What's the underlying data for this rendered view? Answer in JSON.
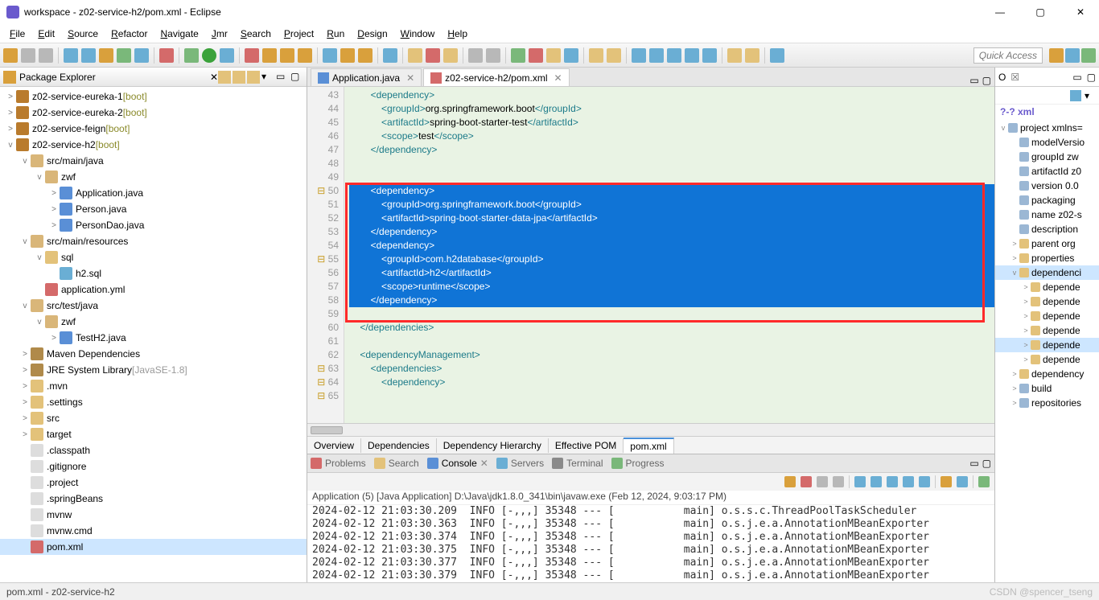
{
  "window": {
    "title": "workspace - z02-service-h2/pom.xml - Eclipse",
    "min": "—",
    "max": "▢",
    "close": "✕"
  },
  "menus": [
    "File",
    "Edit",
    "Source",
    "Refactor",
    "Navigate",
    "Jmr",
    "Search",
    "Project",
    "Run",
    "Design",
    "Window",
    "Help"
  ],
  "quick_access": "Quick Access",
  "pe": {
    "title": "Package Explorer",
    "items": [
      {
        "d": 0,
        "tw": ">",
        "ic": "ic-prj",
        "label": "z02-service-eureka-1",
        "suffix": " [boot]"
      },
      {
        "d": 0,
        "tw": ">",
        "ic": "ic-prj",
        "label": "z02-service-eureka-2",
        "suffix": " [boot]"
      },
      {
        "d": 0,
        "tw": ">",
        "ic": "ic-prj",
        "label": "z02-service-feign",
        "suffix": " [boot]"
      },
      {
        "d": 0,
        "tw": "v",
        "ic": "ic-prj",
        "label": "z02-service-h2",
        "suffix": " [boot]"
      },
      {
        "d": 1,
        "tw": "v",
        "ic": "ic-pkg",
        "label": "src/main/java"
      },
      {
        "d": 2,
        "tw": "v",
        "ic": "ic-pkg",
        "label": "zwf"
      },
      {
        "d": 3,
        "tw": ">",
        "ic": "ic-java",
        "label": "Application.java"
      },
      {
        "d": 3,
        "tw": ">",
        "ic": "ic-java",
        "label": "Person.java"
      },
      {
        "d": 3,
        "tw": ">",
        "ic": "ic-java",
        "label": "PersonDao.java"
      },
      {
        "d": 1,
        "tw": "v",
        "ic": "ic-pkg",
        "label": "src/main/resources"
      },
      {
        "d": 2,
        "tw": "v",
        "ic": "ic-fld",
        "label": "sql"
      },
      {
        "d": 3,
        "tw": "",
        "ic": "ic-sql",
        "label": "h2.sql"
      },
      {
        "d": 2,
        "tw": "",
        "ic": "ic-yml",
        "label": "application.yml"
      },
      {
        "d": 1,
        "tw": "v",
        "ic": "ic-pkg",
        "label": "src/test/java"
      },
      {
        "d": 2,
        "tw": "v",
        "ic": "ic-pkg",
        "label": "zwf"
      },
      {
        "d": 3,
        "tw": ">",
        "ic": "ic-java",
        "label": "TestH2.java"
      },
      {
        "d": 1,
        "tw": ">",
        "ic": "ic-lib",
        "label": "Maven Dependencies"
      },
      {
        "d": 1,
        "tw": ">",
        "ic": "ic-lib",
        "label": "JRE System Library",
        "suffix": " [JavaSE-1.8]",
        "sfx": "javase"
      },
      {
        "d": 1,
        "tw": ">",
        "ic": "ic-fld",
        "label": ".mvn"
      },
      {
        "d": 1,
        "tw": ">",
        "ic": "ic-fld",
        "label": ".settings"
      },
      {
        "d": 1,
        "tw": ">",
        "ic": "ic-fld",
        "label": "src"
      },
      {
        "d": 1,
        "tw": ">",
        "ic": "ic-fld",
        "label": "target"
      },
      {
        "d": 1,
        "tw": "",
        "ic": "ic-file",
        "label": ".classpath"
      },
      {
        "d": 1,
        "tw": "",
        "ic": "ic-file",
        "label": ".gitignore"
      },
      {
        "d": 1,
        "tw": "",
        "ic": "ic-file",
        "label": ".project"
      },
      {
        "d": 1,
        "tw": "",
        "ic": "ic-file",
        "label": ".springBeans"
      },
      {
        "d": 1,
        "tw": "",
        "ic": "ic-file",
        "label": "mvnw"
      },
      {
        "d": 1,
        "tw": "",
        "ic": "ic-file",
        "label": "mvnw.cmd"
      },
      {
        "d": 1,
        "tw": "",
        "ic": "ic-xml",
        "label": "pom.xml",
        "sel": true
      }
    ]
  },
  "editor": {
    "tabs": [
      {
        "label": "Application.java",
        "ic": "ic-java",
        "active": false
      },
      {
        "label": "z02-service-h2/pom.xml",
        "ic": "ic-xml",
        "active": true
      }
    ],
    "lines": [
      {
        "n": 43,
        "html": "        <span class='tag'>&lt;dependency&gt;</span>"
      },
      {
        "n": 44,
        "html": "            <span class='tag'>&lt;groupId&gt;</span><span class='txt'>org.springframework.boot</span><span class='tag'>&lt;/groupId&gt;</span>"
      },
      {
        "n": 45,
        "html": "            <span class='tag'>&lt;artifactId&gt;</span><span class='txt'>spring-boot-starter-test</span><span class='tag'>&lt;/artifactId&gt;</span>"
      },
      {
        "n": 46,
        "html": "            <span class='tag'>&lt;scope&gt;</span><span class='txt'>test</span><span class='tag'>&lt;/scope&gt;</span>"
      },
      {
        "n": 47,
        "html": "        <span class='tag'>&lt;/dependency&gt;</span>"
      },
      {
        "n": 48,
        "html": ""
      },
      {
        "n": 49,
        "html": ""
      },
      {
        "n": 50,
        "sel": true,
        "warn": true,
        "html": "        &lt;dependency&gt;"
      },
      {
        "n": 51,
        "sel": true,
        "html": "            &lt;groupId&gt;org.springframework.boot&lt;/groupId&gt;"
      },
      {
        "n": 52,
        "sel": true,
        "html": "            &lt;artifactId&gt;spring-boot-starter-data-jpa&lt;/artifactId&gt;"
      },
      {
        "n": 53,
        "sel": true,
        "html": "        &lt;/dependency&gt;"
      },
      {
        "n": 54,
        "sel": true,
        "html": ""
      },
      {
        "n": 55,
        "sel": true,
        "warn": true,
        "html": "        &lt;dependency&gt;"
      },
      {
        "n": 56,
        "sel": true,
        "html": "            &lt;groupId&gt;com.h2database&lt;/groupId&gt;"
      },
      {
        "n": 57,
        "sel": true,
        "html": "            &lt;artifactId&gt;h2&lt;/artifactId&gt;"
      },
      {
        "n": 58,
        "sel": true,
        "html": "            &lt;scope&gt;runtime&lt;/scope&gt;"
      },
      {
        "n": 59,
        "sel": true,
        "html": "        &lt;/dependency&gt;"
      },
      {
        "n": 60,
        "html": ""
      },
      {
        "n": 61,
        "html": "    <span class='tag'>&lt;/dependencies&gt;</span>"
      },
      {
        "n": 62,
        "html": ""
      },
      {
        "n": 63,
        "warn": true,
        "html": "    <span class='tag'>&lt;dependencyManagement&gt;</span>"
      },
      {
        "n": 64,
        "warn": true,
        "html": "        <span class='tag'>&lt;dependencies&gt;</span>"
      },
      {
        "n": 65,
        "warn": true,
        "html": "            <span class='tag'>&lt;dependency&gt;</span>"
      }
    ],
    "bottom_tabs": [
      "Overview",
      "Dependencies",
      "Dependency Hierarchy",
      "Effective POM",
      "pom.xml"
    ],
    "bottom_active": 4
  },
  "views": {
    "tabs": [
      {
        "label": "Problems",
        "ic": "#d46a6a"
      },
      {
        "label": "Search",
        "ic": "#e3c27a"
      },
      {
        "label": "Console",
        "ic": "#5a8fd6",
        "active": true
      },
      {
        "label": "Servers",
        "ic": "#6aaed4"
      },
      {
        "label": "Terminal",
        "ic": "#8a8a8a"
      },
      {
        "label": "Progress",
        "ic": "#7ab87a"
      }
    ],
    "console_header": "Application (5) [Java Application] D:\\Java\\jdk1.8.0_341\\bin\\javaw.exe (Feb 12, 2024, 9:03:17 PM)",
    "console_lines": [
      "2024-02-12 21:03:30.209  INFO [-,,,] 35348 --- [           main] o.s.s.c.ThreadPoolTaskScheduler",
      "2024-02-12 21:03:30.363  INFO [-,,,] 35348 --- [           main] o.s.j.e.a.AnnotationMBeanExporter",
      "2024-02-12 21:03:30.374  INFO [-,,,] 35348 --- [           main] o.s.j.e.a.AnnotationMBeanExporter",
      "2024-02-12 21:03:30.375  INFO [-,,,] 35348 --- [           main] o.s.j.e.a.AnnotationMBeanExporter",
      "2024-02-12 21:03:30.377  INFO [-,,,] 35348 --- [           main] o.s.j.e.a.AnnotationMBeanExporter",
      "2024-02-12 21:03:30.379  INFO [-,,,] 35348 --- [           main] o.s.j.e.a.AnnotationMBeanExporter"
    ]
  },
  "outline": {
    "tabs": [
      "O",
      "☒"
    ],
    "xml_label": "?-? xml",
    "items": [
      {
        "d": 0,
        "tw": "v",
        "ic": "ic-el",
        "label": "project xmlns="
      },
      {
        "d": 1,
        "tw": "",
        "ic": "ic-el",
        "label": "modelVersio"
      },
      {
        "d": 1,
        "tw": "",
        "ic": "ic-el",
        "label": "groupId  zw"
      },
      {
        "d": 1,
        "tw": "",
        "ic": "ic-el",
        "label": "artifactId  z0"
      },
      {
        "d": 1,
        "tw": "",
        "ic": "ic-el",
        "label": "version  0.0"
      },
      {
        "d": 1,
        "tw": "",
        "ic": "ic-el",
        "label": "packaging"
      },
      {
        "d": 1,
        "tw": "",
        "ic": "ic-el",
        "label": "name  z02-s"
      },
      {
        "d": 1,
        "tw": "",
        "ic": "ic-el",
        "label": "description"
      },
      {
        "d": 1,
        "tw": ">",
        "ic": "ic-cy",
        "label": "parent  org"
      },
      {
        "d": 1,
        "tw": ">",
        "ic": "ic-cy",
        "label": "properties"
      },
      {
        "d": 1,
        "tw": "v",
        "ic": "ic-cy",
        "label": "dependenci",
        "sel": true
      },
      {
        "d": 2,
        "tw": ">",
        "ic": "ic-cy",
        "label": "depende"
      },
      {
        "d": 2,
        "tw": ">",
        "ic": "ic-cy",
        "label": "depende"
      },
      {
        "d": 2,
        "tw": ">",
        "ic": "ic-cy",
        "label": "depende"
      },
      {
        "d": 2,
        "tw": ">",
        "ic": "ic-cy",
        "label": "depende"
      },
      {
        "d": 2,
        "tw": ">",
        "ic": "ic-cy",
        "label": "depende",
        "hl": true
      },
      {
        "d": 2,
        "tw": ">",
        "ic": "ic-cy",
        "label": "depende"
      },
      {
        "d": 1,
        "tw": ">",
        "ic": "ic-cy",
        "label": "dependency"
      },
      {
        "d": 1,
        "tw": ">",
        "ic": "ic-el",
        "label": "build"
      },
      {
        "d": 1,
        "tw": ">",
        "ic": "ic-el",
        "label": "repositories"
      }
    ]
  },
  "status": {
    "text": "pom.xml - z02-service-h2",
    "watermark": "CSDN @spencer_tseng"
  }
}
